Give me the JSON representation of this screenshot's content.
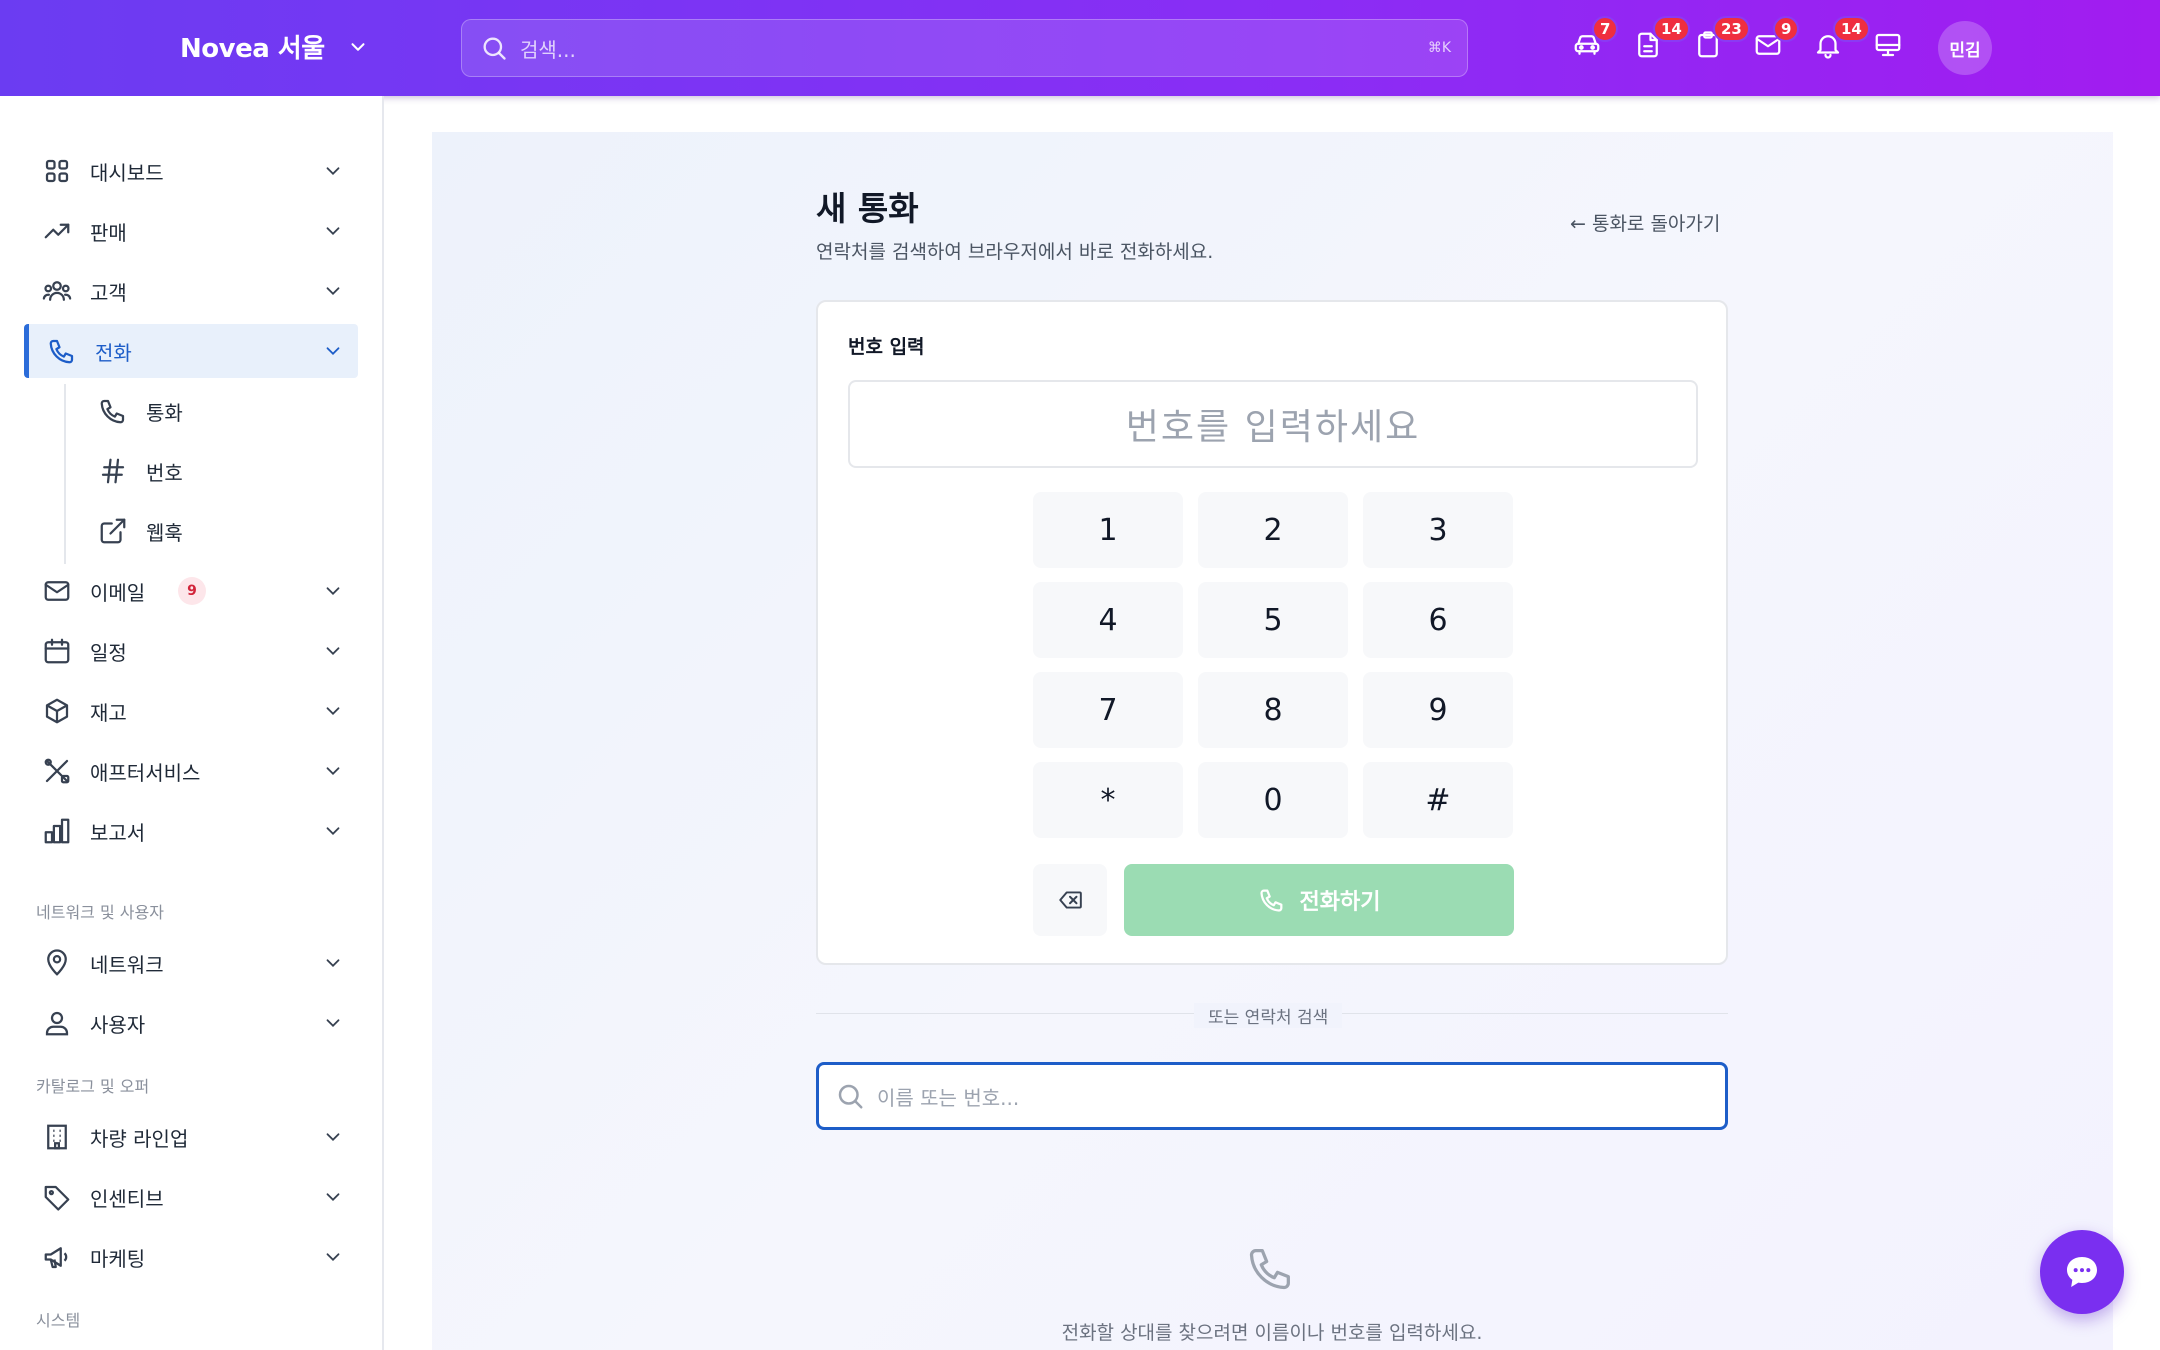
{
  "topbar": {
    "brand": "Novea 서울",
    "search_placeholder": "검색...",
    "search_shortcut": "⌘K",
    "icons": [
      {
        "name": "car-icon",
        "badge": "7"
      },
      {
        "name": "document-icon",
        "badge": "14"
      },
      {
        "name": "clipboard-icon",
        "badge": "23"
      },
      {
        "name": "mail-icon",
        "badge": "9"
      },
      {
        "name": "bell-icon",
        "badge": "14"
      },
      {
        "name": "monitor-icon",
        "badge": ""
      }
    ],
    "avatar_initials": "민김"
  },
  "sidebar": {
    "items": [
      {
        "label": "대시보드",
        "icon": "dashboard-grid-icon"
      },
      {
        "label": "판매",
        "icon": "trending-up-icon"
      },
      {
        "label": "고객",
        "icon": "users-icon"
      },
      {
        "label": "전화",
        "icon": "phone-icon",
        "active": true
      },
      {
        "label": "이메일",
        "icon": "mail-icon",
        "badge": "9"
      },
      {
        "label": "일정",
        "icon": "calendar-icon"
      },
      {
        "label": "재고",
        "icon": "box-icon"
      },
      {
        "label": "애프터서비스",
        "icon": "tools-icon"
      },
      {
        "label": "보고서",
        "icon": "bar-chart-icon"
      },
      {
        "label": "네트워크",
        "icon": "map-pin-icon"
      },
      {
        "label": "사용자",
        "icon": "user-icon"
      },
      {
        "label": "차량 라인업",
        "icon": "building-icon"
      },
      {
        "label": "인센티브",
        "icon": "tag-icon"
      },
      {
        "label": "마케팅",
        "icon": "megaphone-icon"
      }
    ],
    "subitems": [
      {
        "label": "통화",
        "icon": "phone-icon"
      },
      {
        "label": "번호",
        "icon": "hash-icon"
      },
      {
        "label": "웹훅",
        "icon": "external-link-icon"
      }
    ],
    "sections": [
      "네트워크 및 사용자",
      "카탈로그 및 오퍼",
      "시스템"
    ]
  },
  "main": {
    "title": "새 통화",
    "subtitle": "연락처를 검색하여 브라우저에서 바로 전화하세요.",
    "back_link": "← 통화로 돌아가기",
    "card_label": "번호 입력",
    "number_placeholder": "번호를 입력하세요",
    "keys": [
      "1",
      "2",
      "3",
      "4",
      "5",
      "6",
      "7",
      "8",
      "9",
      "*",
      "0",
      "#"
    ],
    "call_button": "전화하기",
    "divider_text": "또는 연락처 검색",
    "contact_search_placeholder": "이름 또는 번호...",
    "empty_text": "전화할 상대를 찾으려면 이름이나 번호를 입력하세요."
  },
  "colors": {
    "topbar_start": "#6b3cf2",
    "topbar_end": "#a21cf0",
    "active": "#1d5dc8",
    "call_button": "#9bdcb3",
    "badge": "#ef2e3f"
  }
}
